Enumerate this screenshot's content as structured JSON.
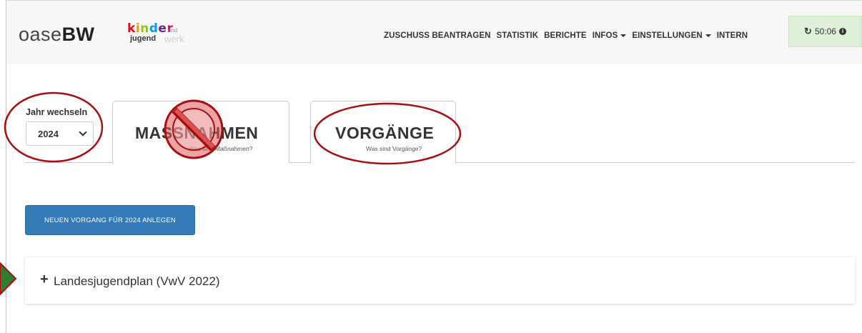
{
  "header": {
    "brand_light": "oase",
    "brand_bold": "BW",
    "logo": {
      "line1": [
        "k",
        "i",
        "n",
        "d",
        "e",
        "r"
      ],
      "und": "und",
      "line2": "jugend",
      "line3": "werk"
    },
    "menu": [
      {
        "label": "ZUSCHUSS BEANTRAGEN",
        "dropdown": false
      },
      {
        "label": "STATISTIK",
        "dropdown": false
      },
      {
        "label": "BERICHTE",
        "dropdown": false
      },
      {
        "label": "INFOS",
        "dropdown": true
      },
      {
        "label": "EINSTELLUNGEN",
        "dropdown": true
      },
      {
        "label": "INTERN",
        "dropdown": false
      }
    ],
    "timer": {
      "value": "50:06",
      "icon": "refresh-icon",
      "info_icon": "info-icon"
    }
  },
  "year": {
    "label": "Jahr wechseln",
    "selected": "2024"
  },
  "tabs": [
    {
      "title": "MASSNAHMEN",
      "subtitle": "Was sind Maßnahmen?"
    },
    {
      "title": "VORGÄNGE",
      "subtitle": "Was sind Vorgänge?"
    }
  ],
  "new_button": {
    "label": "NEUEN VORGANG FÜR 2024 ANLEGEN"
  },
  "panel": {
    "title": "Landesjugendplan (VwV 2022)",
    "icon": "plus-icon"
  },
  "colors": {
    "primary": "#337ab7",
    "timer_bg": "#dff0d8",
    "annotation_red": "#a50f12",
    "arrow_fill": "#2e7d32"
  }
}
